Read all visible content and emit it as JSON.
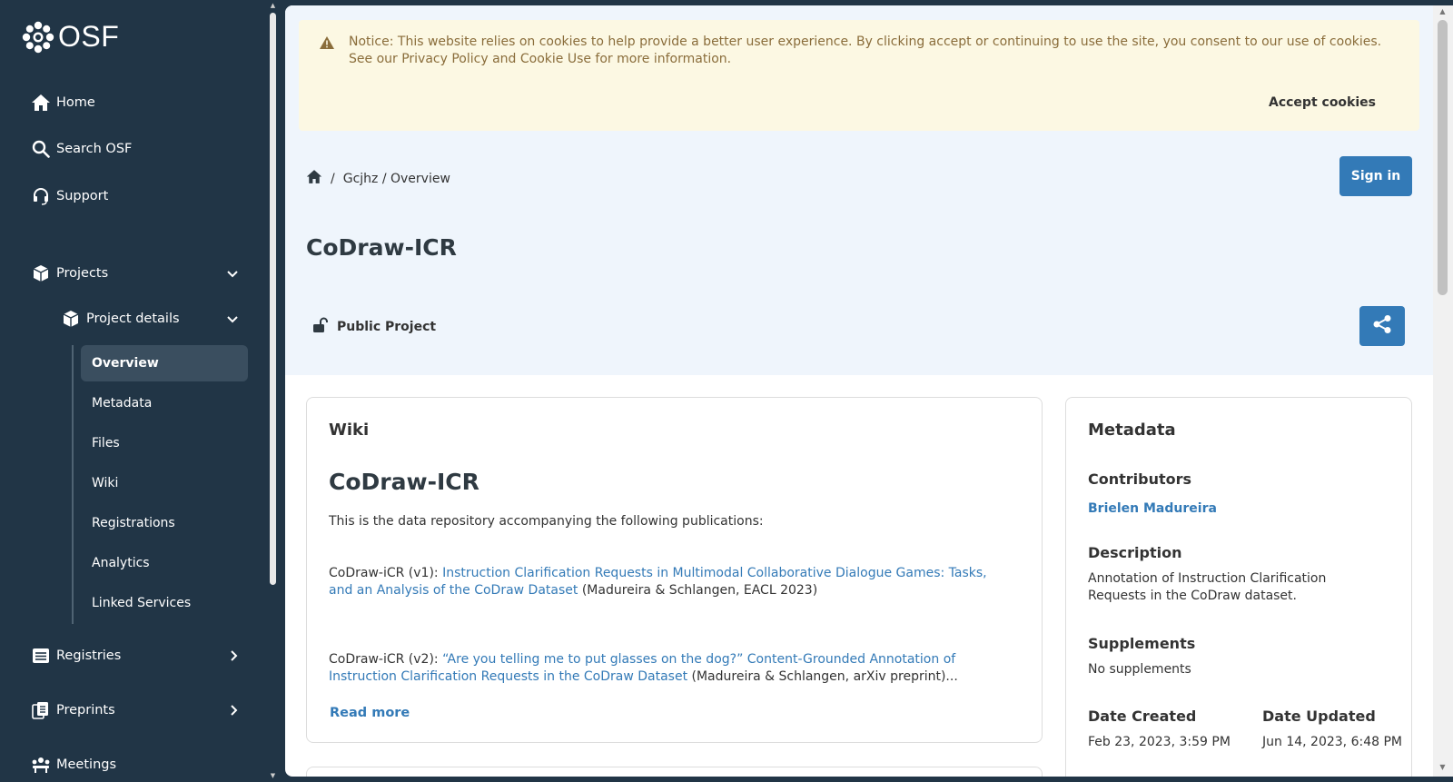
{
  "sidebar": {
    "logo_text": "OSF",
    "nav": {
      "home": "Home",
      "search": "Search OSF",
      "support": "Support",
      "projects": "Projects",
      "project_details": "Project details",
      "registries": "Registries",
      "preprints": "Preprints",
      "meetings": "Meetings"
    },
    "sub_items": [
      "Overview",
      "Metadata",
      "Files",
      "Wiki",
      "Registrations",
      "Analytics",
      "Linked Services"
    ],
    "active_sub_item": "Overview"
  },
  "cookie_notice": {
    "text": "Notice: This website relies on cookies to help provide a better user experience. By clicking accept or continuing to use the site, you consent to our use of cookies. See our Privacy Policy and Cookie Use for more information.",
    "accept_label": "Accept cookies"
  },
  "breadcrumb": {
    "separator": "/",
    "path": "Gcjhz / Overview"
  },
  "header": {
    "signin_label": "Sign in",
    "title": "CoDraw-ICR",
    "visibility": "Public Project"
  },
  "wiki": {
    "heading": "Wiki",
    "title": "CoDraw-ICR",
    "intro": "This is the data repository accompanying the following publications:",
    "pub1_prefix": "CoDraw-iCR (v1): ",
    "pub1_link": "Instruction Clarification Requests in Multimodal Collaborative Dialogue Games: Tasks, and an Analysis of the CoDraw Dataset",
    "pub1_suffix": " (Madureira & Schlangen, EACL 2023)",
    "pub2_prefix": "CoDraw-iCR (v2): ",
    "pub2_link": "“Are you telling me to put glasses on the dog?” Content-Grounded Annotation of Instruction Clarification Requests in the CoDraw Dataset",
    "pub2_suffix": " (Madureira & Schlangen, arXiv preprint)...",
    "read_more": "Read more"
  },
  "metadata": {
    "heading": "Metadata",
    "contributors_label": "Contributors",
    "contributor": "Brielen Madureira",
    "description_label": "Description",
    "description": "Annotation of Instruction Clarification Requests in the CoDraw dataset.",
    "supplements_label": "Supplements",
    "supplements": "No supplements",
    "date_created_label": "Date Created",
    "date_created": "Feb 23, 2023, 3:59 PM",
    "date_updated_label": "Date Updated",
    "date_updated": "Jun 14, 2023, 6:48 PM"
  },
  "colors": {
    "sidebar_bg": "#213546",
    "accent": "#337ab7",
    "hero_bg": "#eff5fc",
    "cookie_bg": "#fcf8e3",
    "cookie_text": "#8a6d3b"
  },
  "icons": [
    "osf-logo-icon",
    "home-icon",
    "search-icon",
    "headset-icon",
    "cube-icon",
    "registries-icon",
    "preprints-icon",
    "meetings-icon",
    "chevron-down-icon",
    "chevron-right-icon",
    "warning-icon",
    "unlock-icon",
    "share-icon"
  ]
}
